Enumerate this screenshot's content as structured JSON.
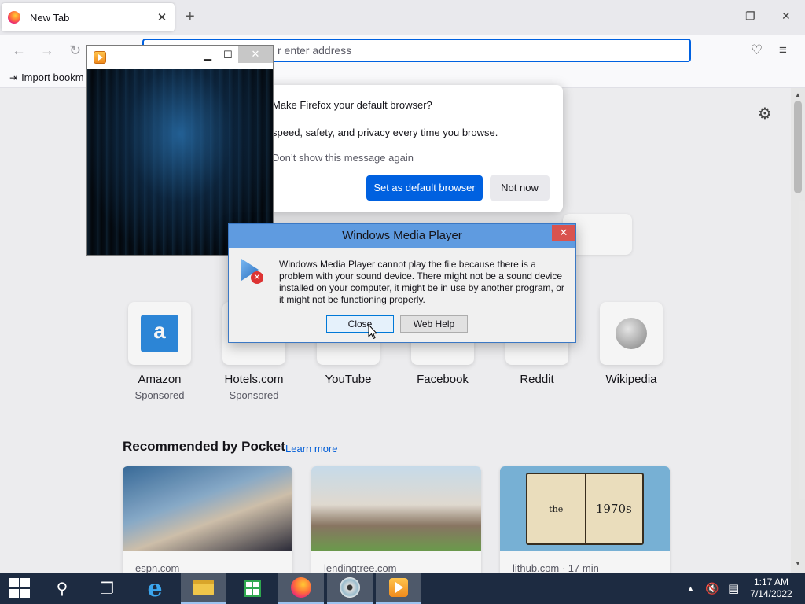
{
  "browser": {
    "tab": {
      "title": "New Tab",
      "close": "✕",
      "new_tab": "+"
    },
    "window_controls": {
      "minimize": "—",
      "restore": "❐",
      "close": "✕"
    },
    "nav": {
      "back": "←",
      "forward": "→",
      "reload": "↻",
      "address_placeholder": "r enter address",
      "pocket": "♡",
      "menu": "≡"
    },
    "bookmarks": {
      "import_label": "Import bookm",
      "import_icon": "⇥"
    }
  },
  "newtab": {
    "settings_icon": "⚙",
    "top_sites": [
      {
        "name": "Amazon",
        "sponsor": "Sponsored"
      },
      {
        "name": "Hotels.com",
        "sponsor": "Sponsored"
      },
      {
        "name": "YouTube",
        "sponsor": ""
      },
      {
        "name": "Facebook",
        "sponsor": ""
      },
      {
        "name": "Reddit",
        "sponsor": ""
      },
      {
        "name": "Wikipedia",
        "sponsor": ""
      }
    ],
    "amazon_logo": "a",
    "pocket": {
      "title": "Recommended by Pocket",
      "learn_more": "Learn more",
      "cards": [
        {
          "source": "espn.com"
        },
        {
          "source": "lendingtree.com"
        },
        {
          "source": "lithub.com · 17 min",
          "book_left": "the",
          "book_right": "1970s"
        }
      ]
    }
  },
  "default_browser_modal": {
    "title": "Make Firefox your default browser?",
    "body": "speed, safety, and privacy every time you browse.",
    "dont_show": "Don’t show this message again",
    "set_default": "Set as default browser",
    "not_now": "Not now"
  },
  "wmp_window": {
    "minimize": "▁",
    "maximize": "☐",
    "close": "✕"
  },
  "error_dialog": {
    "title": "Windows Media Player",
    "close": "✕",
    "icon_x": "✕",
    "message": "Windows Media Player cannot play the file because there is a problem with your sound device. There might not be a sound device installed on your computer, it might be in use by another program, or it might not be functioning properly.",
    "close_button": "Close",
    "web_help_button": "Web Help"
  },
  "taskbar": {
    "search_icon": "⚲",
    "task_view_icon": "❐",
    "ie_icon": "e",
    "tray_chevron": "▲",
    "tray_volume": "🔇",
    "tray_notifications": "▤",
    "time": "1:17 AM",
    "date": "7/14/2022"
  },
  "colors": {
    "accent": "#0061e0",
    "taskbar": "#1d2b41",
    "dialog_titlebar": "#5f9be0"
  }
}
